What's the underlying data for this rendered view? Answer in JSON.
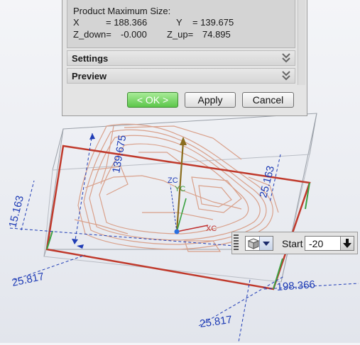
{
  "dialog": {
    "product_size": {
      "heading": "Product Maximum Size:",
      "x_label": "X",
      "x_value": "= 188.366",
      "y_label": "Y",
      "y_value": "= 139.675",
      "zdown_label": "Z_down=",
      "zdown_value": "-0.000",
      "zup_label": "Z_up=",
      "zup_value": "74.895"
    },
    "sections": [
      {
        "label": "Settings",
        "icon": "chevron-double-down-icon"
      },
      {
        "label": "Preview",
        "icon": "chevron-double-down-icon"
      }
    ],
    "buttons": {
      "ok": "< OK >",
      "apply": "Apply",
      "cancel": "Cancel"
    }
  },
  "view": {
    "dimensions": {
      "height_left": "15.163",
      "height_right": "25.163",
      "vertical_model": "139.675",
      "bottom_left": "25.817",
      "bottom_right": "25.817",
      "length": "198.366"
    },
    "axes": {
      "zc": "ZC",
      "yc": "YC",
      "xc": "XC"
    },
    "colors": {
      "bounding_box": "#c0392b",
      "dimension": "#1f3cb5",
      "model": "#d9a08a",
      "wcs_z": "#8a6d1e",
      "wcs_x": "#c03030",
      "wcs_y": "#3aa040"
    }
  },
  "start_control": {
    "type_icon": "cube-icon",
    "label": "Start",
    "value": "-20"
  }
}
